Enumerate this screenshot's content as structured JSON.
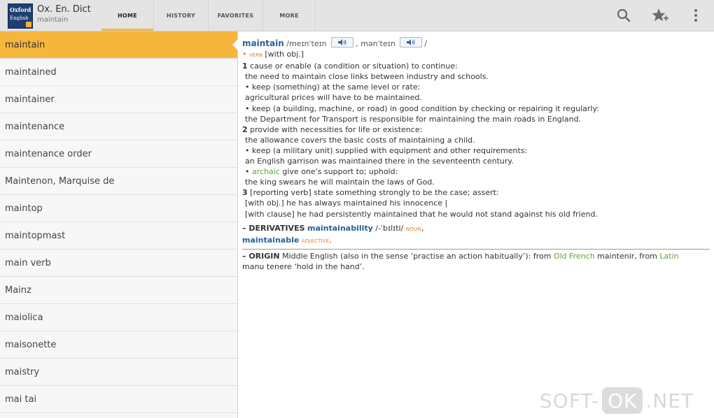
{
  "app": {
    "title": "Ox. En. Dict",
    "subtitle": "maintain",
    "icon_line1": "Oxford",
    "icon_line2": "English"
  },
  "tabs": [
    {
      "label": "HOME",
      "active": true
    },
    {
      "label": "HISTORY",
      "active": false
    },
    {
      "label": "FAVORITES",
      "active": false
    },
    {
      "label": "MORE",
      "active": false
    }
  ],
  "toolbar_icons": [
    "search-icon",
    "add-favorite-star-icon",
    "overflow-menu-icon"
  ],
  "colors": {
    "accent": "#f4b740",
    "selected_row": "#f6b63d",
    "headword": "#2d5f96",
    "pos": "#e07d2b",
    "link_green": "#5da33a"
  },
  "list": {
    "items": [
      "maintain",
      "maintained",
      "maintainer",
      "maintenance",
      "maintenance order",
      "Maintenon, Marquise de",
      "maintop",
      "maintopmast",
      "main verb",
      "Mainz",
      "maiolica",
      "maisonette",
      "maistry",
      "mai tai"
    ],
    "selected_index": 0
  },
  "entry": {
    "headword": "maintain",
    "pron1": "/meɪnˈteɪn",
    "pron_sep": ", ",
    "pron2": "mənˈteɪn",
    "pron_end": "/",
    "pos_bullet": "•",
    "pos": "VERB",
    "grammar": "[with obj.]",
    "s1_num": "1",
    "s1_def": "cause or enable (a condition or situation) to continue:",
    "s1_ex": "the need to maintain close links between industry and schools.",
    "s1a_def": "• keep (something) at the same level or rate:",
    "s1a_ex": "agricultural prices will have to be maintained.",
    "s1b_def": "• keep (a building, machine, or road) in good condition by checking or repairing it regularly:",
    "s1b_ex": "the Department for Transport is responsible for maintaining the main roads in England.",
    "s2_num": "2",
    "s2_def": "provide with necessities for life or existence:",
    "s2_ex": "the allowance covers the basic costs of maintaining a child.",
    "s2a_def": "• keep (a military unit) supplied with equipment and other requirements:",
    "s2a_ex": "an English garrison was maintained there in the seventeenth century.",
    "s2b_bullet": "•",
    "s2b_label": "archaic",
    "s2b_def": " give one's support to; uphold:",
    "s2b_ex": "the king swears he will maintain the laws of God.",
    "s3_num": "3",
    "s3_def": "[reporting verb] state something strongly to be the case; assert:",
    "s3_ex1": "[with obj.] he has always maintained his innocence |",
    "s3_ex2": "[with clause] he had persistently maintained that he would not stand against his old friend.",
    "deriv_label": "– DERIVATIVES",
    "deriv1": "maintainability",
    "deriv1_pron": " /-ˈbɪlɪti/ ",
    "deriv1_pos": "NOUN",
    "deriv_sep": ",",
    "deriv2": "maintainable",
    "deriv2_pos": "ADJECTIVE",
    "deriv_end": ".",
    "origin_label": "– ORIGIN",
    "origin_a": " Middle English (also in the sense ‘practise an action habitually’): from ",
    "origin_of": "Old French",
    "origin_b": " maintenir, from ",
    "origin_latin": "Latin",
    "origin_c": "manu tenere ‘hold in the hand’."
  },
  "watermark": {
    "left": "SOFT-",
    "ok": "OK",
    "right": ".NET"
  }
}
